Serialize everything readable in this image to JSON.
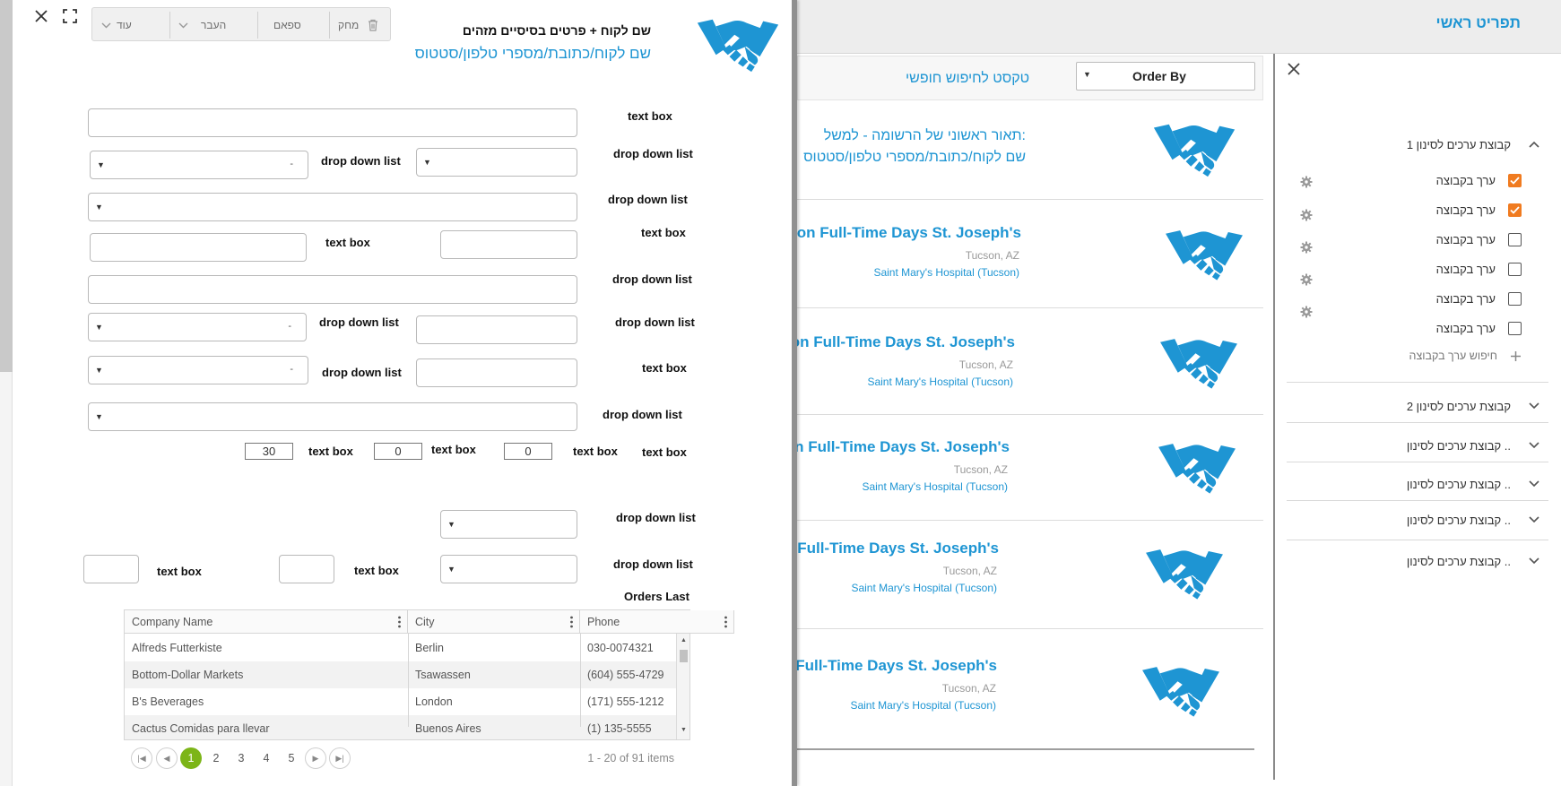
{
  "app": {
    "main_menu": "תפריט ראשי",
    "accent": "#1e95d3",
    "checked_color": "#f07b20",
    "pager_active_color": "#7cb518"
  },
  "filters": {
    "groups": [
      {
        "label": "קבוצת ערכים לסינון 1",
        "expanded": true
      },
      {
        "label": "קבוצת ערכים לסינון 2",
        "expanded": false
      },
      {
        "label": "קבוצת ערכים לסינון ..",
        "expanded": false
      },
      {
        "label": "קבוצת ערכים לסינון ..",
        "expanded": false
      },
      {
        "label": "קבוצת ערכים לסינון ..",
        "expanded": false
      },
      {
        "label": "קבוצת ערכים לסינון ..",
        "expanded": false
      }
    ],
    "values": [
      {
        "label": "ערך בקבוצה",
        "checked": true
      },
      {
        "label": "ערך בקבוצה",
        "checked": true
      },
      {
        "label": "ערך בקבוצה",
        "checked": false
      },
      {
        "label": "ערך בקבוצה",
        "checked": false
      },
      {
        "label": "ערך בקבוצה",
        "checked": false
      },
      {
        "label": "ערך בקבוצה",
        "checked": false
      }
    ],
    "search_value": "חיפוש ערך בקבוצה"
  },
  "list": {
    "free_text_search": "טקסט לחיפוש חופשי",
    "order_by": "Order By",
    "first_card": {
      "line1": "תאור ראשוני של הרשומה - למשל:",
      "line2": "שם לקוח/כתובת/מספרי טלפון/סטטוס"
    },
    "cards": [
      {
        "title": "Nurse Observation Full-Time Days St. Joseph's",
        "location": "Tucson, AZ",
        "org": "Saint Mary's Hospital (Tucson)"
      },
      {
        "title": "urse Observation Full-Time Days St. Joseph's",
        "location": "Tucson, AZ",
        "org": "Saint Mary's Hospital (Tucson)"
      },
      {
        "title": "urse Observation Full-Time Days St. Joseph's",
        "location": "Tucson, AZ",
        "org": "Saint Mary's Hospital (Tucson)"
      },
      {
        "title": "se Observation Full-Time Days St. Joseph's",
        "location": "Tucson, AZ",
        "org": "Saint Mary's Hospital (Tucson)"
      },
      {
        "title": "se Observation Full-Time Days St. Joseph's",
        "location": "Tucson, AZ",
        "org": "Saint Mary's Hospital (Tucson)"
      }
    ]
  },
  "modal": {
    "toolbar": {
      "delete": "מחק",
      "spam": "ספאם",
      "move": "העבר",
      "more": "עוד"
    },
    "header_title": "שם לקוח + פרטים בסיסיים מזהים",
    "header_sub": "שם לקוח/כתובת/מספרי טלפון/סטטוס",
    "labels": {
      "text_box": "text box",
      "drop_down_list": "drop down list",
      "orders_last": "Orders Last"
    },
    "dash": "-",
    "numbers": {
      "a": "30",
      "b": "0",
      "c": "0"
    },
    "grid": {
      "columns": [
        "Company Name",
        "City",
        "Phone"
      ],
      "rows": [
        [
          "Alfreds Futterkiste",
          "Berlin",
          "030-0074321"
        ],
        [
          "Bottom-Dollar Markets",
          "Tsawassen",
          "(604) 555-4729"
        ],
        [
          "B's Beverages",
          "London",
          "(171) 555-1212"
        ],
        [
          "Cactus Comidas para llevar",
          "Buenos Aires",
          "(1) 135-5555"
        ]
      ],
      "pages": [
        "1",
        "2",
        "3",
        "4",
        "5"
      ],
      "current_page": "1",
      "info": "1 - 20 of 91 items"
    }
  }
}
